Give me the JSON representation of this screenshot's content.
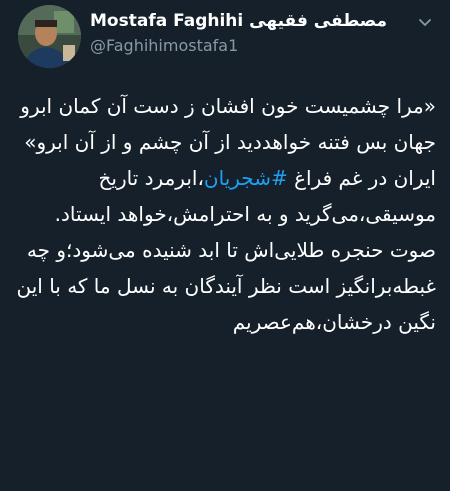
{
  "author": {
    "display_name": "Mostafa Faghihi مصطفی فقیهی",
    "handle": "@Faghihimostafa1"
  },
  "icons": {
    "avatar": "profile-photo",
    "menu": "chevron-down-icon"
  },
  "colors": {
    "background": "#15202b",
    "text": "#ffffff",
    "secondary_text": "#8899a6",
    "hashtag": "#1da1f2"
  },
  "tweet": {
    "para1": "«مرا چشمیست خون افشان ز دست آن کمان ابرو",
    "para2": "جهان بس فتنه خواهددید از آن چشم و از آن ابرو»",
    "para3_before": "ایران در غم فراغ ",
    "hashtag": "#شجریان",
    "para3_after": "،ابرمرد تاریخ موسیقی،می‌گرید و به احترامش،خواهد ایستاد.",
    "para4": "صوت حنجره طلایی‌اش تا ابد شنیده می‌شود؛و چه غبطه‌برانگیز است نظر آیندگان به نسل ما که با این نگین درخشان،هم‌عصریم"
  }
}
